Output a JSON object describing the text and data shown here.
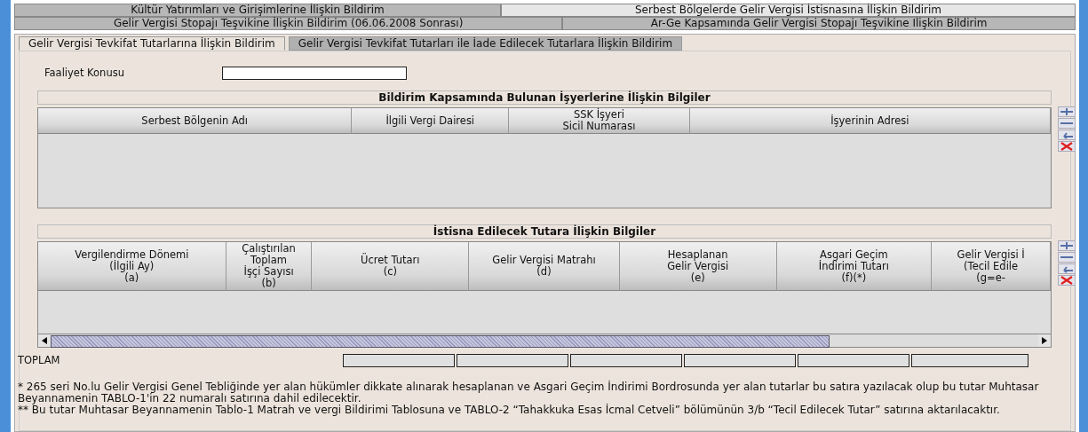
{
  "top_tabs": [
    [
      {
        "label": "Kültür Yatırımları ve Girişimlerine İlişkin Bildirim",
        "selected": false
      },
      {
        "label": "Serbest Bölgelerde Gelir Vergisi İstisnasına İlişkin Bildirim",
        "selected": true
      }
    ],
    [
      {
        "label": "Gelir Vergisi Stopajı Teşvikine İlişkin Bildirim (06.06.2008 Sonrası)",
        "selected": false
      },
      {
        "label": "Ar-Ge Kapsamında Gelir Vergisi Stopajı Teşvikine Ilişkin Bildirim",
        "selected": false
      }
    ]
  ],
  "sub_tabs": [
    {
      "label": "Gelir Vergisi Tevkifat Tutarlarına İlişkin Bildirim",
      "selected": true
    },
    {
      "label": "Gelir Vergisi Tevkifat Tutarları ile İade Edilecek Tutarlara İlişkin Bildirim",
      "selected": false
    }
  ],
  "activity": {
    "label": "Faaliyet Konusu"
  },
  "workplaces": {
    "title": "Bildirim Kapsamında Bulunan İşyerlerine İlişkin Bilgiler",
    "columns": [
      {
        "lines": [
          "Serbest Bölgenin Adı"
        ]
      },
      {
        "lines": [
          "İlgili Vergi Dairesi"
        ]
      },
      {
        "lines": [
          "SSK İşyeri",
          "Sicil Numarası"
        ]
      },
      {
        "lines": [
          "İşyerinin Adresi"
        ]
      }
    ]
  },
  "exemption": {
    "title": "İstisna Edilecek Tutara İlişkin Bilgiler",
    "columns": [
      {
        "lines": [
          "Vergilendirme Dönemi",
          "(İlgili Ay)",
          "(a)"
        ]
      },
      {
        "lines": [
          "Çalıştırılan",
          "Toplam",
          "İşçi Sayısı",
          "(b)"
        ]
      },
      {
        "lines": [
          "Ücret Tutarı",
          "(c)"
        ]
      },
      {
        "lines": [
          "Gelir Vergisi Matrahı",
          "(d)"
        ]
      },
      {
        "lines": [
          "Hesaplanan",
          "Gelir Vergisi",
          "(e)"
        ]
      },
      {
        "lines": [
          "Asgari Geçim",
          "İndirimi Tutarı",
          "(f)(*)"
        ]
      },
      {
        "lines": [
          "Gelir Vergisi İ",
          "(Tecil Edile",
          "(g=e-"
        ]
      }
    ]
  },
  "total": {
    "label": "TOPLAM"
  },
  "footnotes": [
    "* 265 seri No.lu Gelir Vergisi Genel Tebliğinde yer alan hükümler dikkate alınarak hesaplanan ve Asgari Geçim İndirimi Bordrosunda yer alan tutarlar bu satıra yazılacak olup bu tutar Muhtasar Beyannamenin TABLO-1'in 22 numaralı satırına dahil edilecektir.",
    "** Bu tutar Muhtasar Beyannamenin Tablo-1 Matrah ve vergi Bildirimi Tablosuna ve TABLO-2 “Tahakkuka Esas İcmal Cetveli” bölümünün 3/b “Tecil Edilecek Tutar” satırına aktarılacaktır."
  ]
}
